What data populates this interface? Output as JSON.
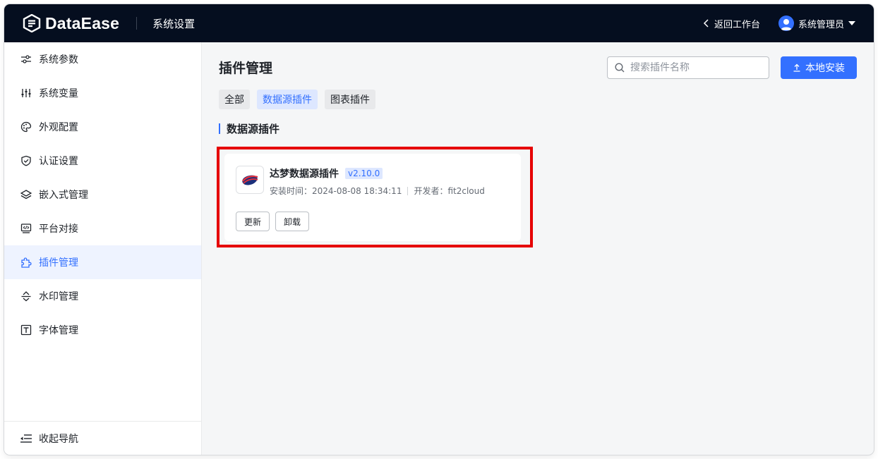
{
  "header": {
    "brand": "DataEase",
    "title": "系统设置",
    "back_label": "返回工作台",
    "user_name": "系统管理员"
  },
  "sidebar": {
    "items": [
      {
        "label": "系统参数",
        "icon": "sliders-icon"
      },
      {
        "label": "系统变量",
        "icon": "variable-icon"
      },
      {
        "label": "外观配置",
        "icon": "palette-icon"
      },
      {
        "label": "认证设置",
        "icon": "shield-icon"
      },
      {
        "label": "嵌入式管理",
        "icon": "layers-icon"
      },
      {
        "label": "平台对接",
        "icon": "platform-icon"
      },
      {
        "label": "插件管理",
        "icon": "puzzle-icon",
        "active": true
      },
      {
        "label": "水印管理",
        "icon": "watermark-icon"
      },
      {
        "label": "字体管理",
        "icon": "font-icon"
      }
    ],
    "collapse_label": "收起导航"
  },
  "main": {
    "title": "插件管理",
    "search_placeholder": "搜索插件名称",
    "install_label": "本地安装",
    "tabs": [
      {
        "label": "全部"
      },
      {
        "label": "数据源插件",
        "active": true
      },
      {
        "label": "图表插件"
      }
    ],
    "section_title": "数据源插件",
    "plugin": {
      "name": "达梦数据源插件",
      "version": "v2.10.0",
      "install_time": "安装时间：2024-08-08 18:34:11",
      "developer": "开发者：fit2cloud",
      "update_label": "更新",
      "uninstall_label": "卸载"
    }
  },
  "colors": {
    "header_bg": "#050e1f",
    "accent": "#3370ff",
    "highlight": "#e60000"
  }
}
